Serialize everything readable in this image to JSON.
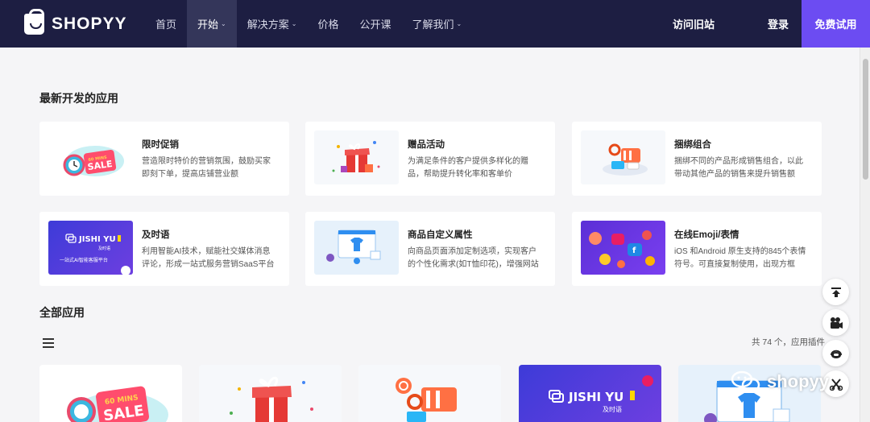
{
  "brand": {
    "name": "SHOPYY"
  },
  "nav": {
    "items": [
      {
        "label": "首页",
        "caret": ""
      },
      {
        "label": "开始",
        "caret": "⌄"
      },
      {
        "label": "解决方案",
        "caret": "⌄"
      },
      {
        "label": "价格",
        "caret": ""
      },
      {
        "label": "公开课",
        "caret": ""
      },
      {
        "label": "了解我们",
        "caret": "⌄"
      }
    ],
    "old_site": "访问旧站",
    "login": "登录",
    "free_trial": "免费试用"
  },
  "latest": {
    "title": "最新开发的应用",
    "cards": [
      {
        "title": "限时促销",
        "desc": "营造限时特价的营销氛围，鼓励买家即刻下单，提高店铺营业额",
        "thumb_text": "60 MINS SALE",
        "icon": "clock-sale-icon"
      },
      {
        "title": "赠品活动",
        "desc": "为满足条件的客户提供多样化的赠品，帮助提升转化率和客单价",
        "thumb_text": "",
        "icon": "gift-box-icon"
      },
      {
        "title": "捆绑组合",
        "desc": "捆绑不同的产品形成销售组合，以此带动其他产品的销售来提升销售额",
        "thumb_text": "",
        "icon": "bundle-icon"
      },
      {
        "title": "及时语",
        "desc": "利用智能AI技术，赋能社交媒体消息评论，形成一站式服务营销SaaS平台",
        "thumb_text": "JISHI YU",
        "thumb_sub": "及时语",
        "thumb_line": "一站式AI智能客服平台",
        "icon": "jishiyu-logo-icon"
      },
      {
        "title": "商品自定义属性",
        "desc": "向商品页面添加定制选项，实现客户的个性化需求(如T恤印花)，增强网站的...",
        "thumb_text": "",
        "icon": "tshirt-custom-icon"
      },
      {
        "title": "在线Emoji/表情",
        "desc": "iOS 和Android 原生支持的845个表情符号。可直接复制使用，出现方框的...",
        "thumb_text": "",
        "icon": "emoji-icon"
      }
    ]
  },
  "all_apps": {
    "title": "全部应用",
    "count_text": "共 74 个，应用插件",
    "tiles": [
      {
        "text": "60 MINS SALE",
        "icon": "clock-sale-icon"
      },
      {
        "text": "",
        "icon": "gift-box-icon"
      },
      {
        "text": "",
        "icon": "bundle-icon"
      },
      {
        "text": "JISHI YU",
        "sub": "及时语",
        "icon": "jishiyu-logo-icon"
      },
      {
        "text": "",
        "icon": "tshirt-custom-icon"
      }
    ]
  },
  "watermark": {
    "text": "shopyy"
  },
  "colors": {
    "header": "#1d1e42",
    "accent": "#6c4cf2",
    "background": "#f5f5f7"
  }
}
